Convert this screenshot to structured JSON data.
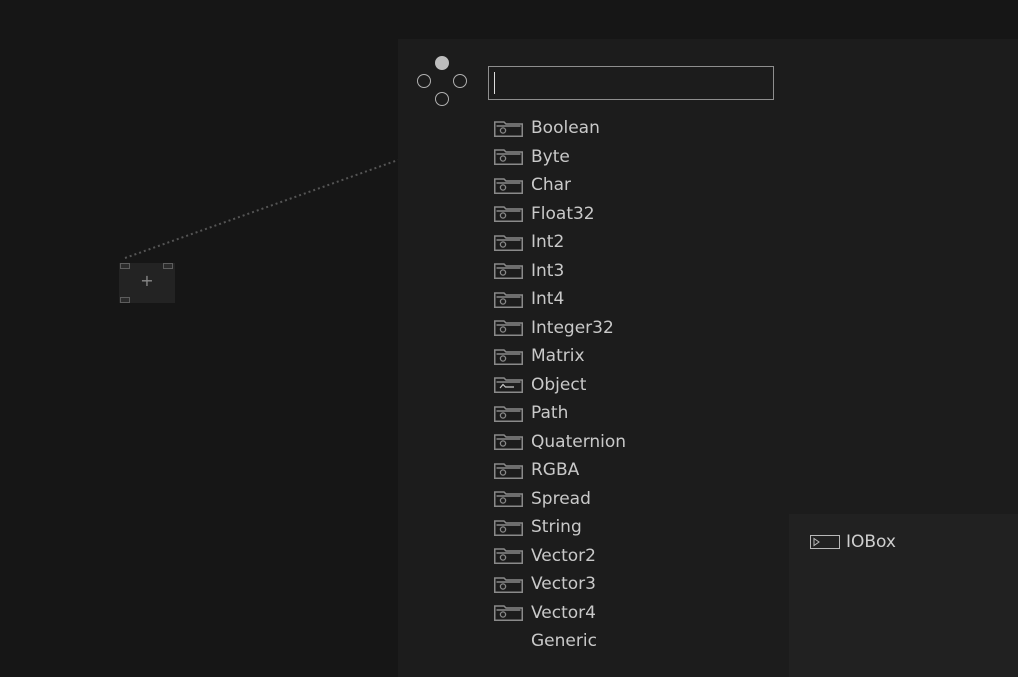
{
  "search": {
    "value": "",
    "placeholder": ""
  },
  "categories": [
    {
      "label": "Boolean",
      "icon": "folder-icon"
    },
    {
      "label": "Byte",
      "icon": "folder-icon"
    },
    {
      "label": "Char",
      "icon": "folder-icon"
    },
    {
      "label": "Float32",
      "icon": "folder-icon"
    },
    {
      "label": "Int2",
      "icon": "folder-icon"
    },
    {
      "label": "Int3",
      "icon": "folder-icon"
    },
    {
      "label": "Int4",
      "icon": "folder-icon"
    },
    {
      "label": "Integer32",
      "icon": "folder-icon"
    },
    {
      "label": "Matrix",
      "icon": "folder-icon"
    },
    {
      "label": "Object",
      "icon": "folder-object-icon"
    },
    {
      "label": "Path",
      "icon": "folder-icon"
    },
    {
      "label": "Quaternion",
      "icon": "folder-icon"
    },
    {
      "label": "RGBA",
      "icon": "folder-icon"
    },
    {
      "label": "Spread",
      "icon": "folder-icon"
    },
    {
      "label": "String",
      "icon": "folder-icon"
    },
    {
      "label": "Vector2",
      "icon": "folder-icon"
    },
    {
      "label": "Vector3",
      "icon": "folder-icon"
    },
    {
      "label": "Vector4",
      "icon": "folder-icon"
    },
    {
      "label": "Generic",
      "icon": ""
    }
  ],
  "subpanel": {
    "items": [
      {
        "label": "IOBox",
        "icon": "iobox-icon"
      }
    ]
  },
  "node": {
    "symbol": "+"
  },
  "colors": {
    "canvas_bg": "#161616",
    "panel_bg": "#1c1c1c",
    "subpanel_bg": "#212121",
    "text": "#c9c9c9",
    "icon": "#8a8a8a"
  }
}
